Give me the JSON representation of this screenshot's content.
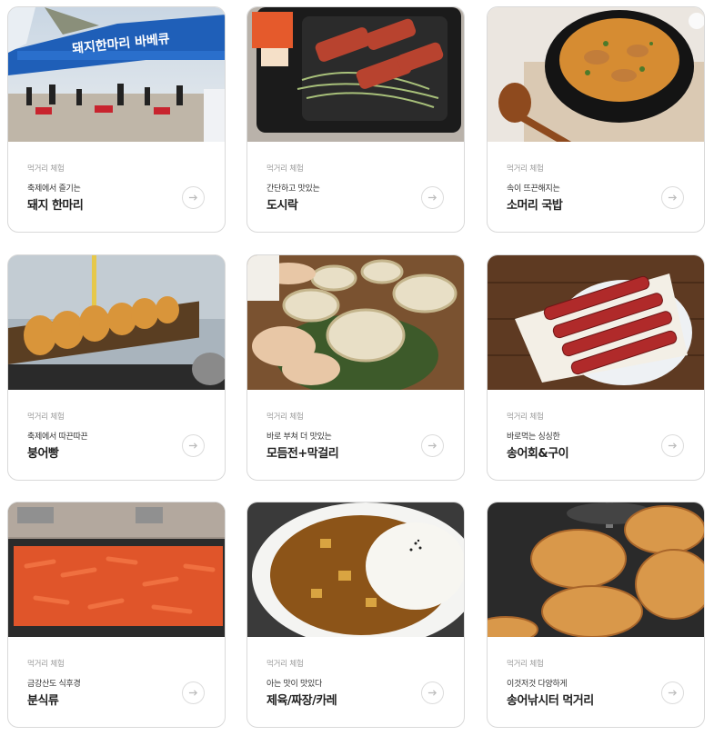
{
  "cards": [
    {
      "category": "먹거리 체험",
      "subtitle": "축제에서 즐기는",
      "title": "돼지 한마리",
      "image": "tent-bbq-photo",
      "sign_text": "돼지한마리 바베큐"
    },
    {
      "category": "먹거리 체험",
      "subtitle": "간단하고 맛있는",
      "title": "도시락",
      "image": "pork-lunchbox-photo"
    },
    {
      "category": "먹거리 체험",
      "subtitle": "속이 뜨끈해지는",
      "title": "소머리 국밥",
      "image": "beef-soup-photo"
    },
    {
      "category": "먹거리 체험",
      "subtitle": "축제에서 따끈따끈",
      "title": "붕어빵",
      "image": "fish-bread-photo"
    },
    {
      "category": "먹거리 체험",
      "subtitle": "바로 부쳐 더 맛있는",
      "title": "모듬전+막걸리",
      "image": "makgeolli-jeon-photo"
    },
    {
      "category": "먹거리 체험",
      "subtitle": "바로먹는 싱싱한",
      "title": "송어회&구이",
      "image": "grilled-trout-photo"
    },
    {
      "category": "먹거리 체험",
      "subtitle": "금강산도 식후경",
      "title": "분식류",
      "image": "tteokbokki-photo"
    },
    {
      "category": "먹거리 체험",
      "subtitle": "아는 맛이 맛있다",
      "title": "제육/짜장/카레",
      "image": "curry-rice-photo"
    },
    {
      "category": "먹거리 체험",
      "subtitle": "이것저것 다양하게",
      "title": "송어낚시터 먹거리",
      "image": "hotteok-photo"
    }
  ],
  "arrow_icon": "arrow-right-icon"
}
